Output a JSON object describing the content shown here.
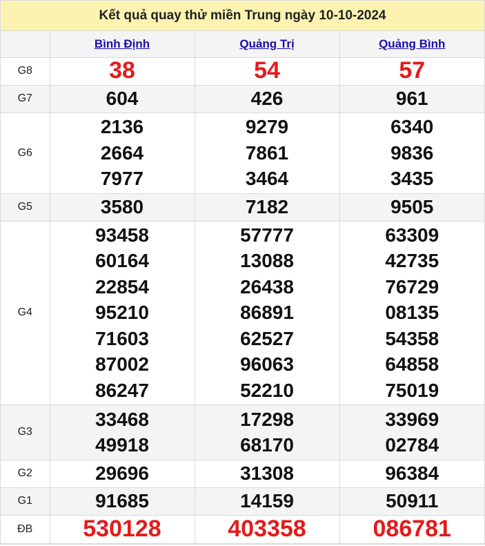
{
  "title": "Kết quả quay thử miền Trung ngày 10-10-2024",
  "provinces": [
    "Bình Định",
    "Quảng Trị",
    "Quảng Bình"
  ],
  "labels": {
    "g8": "G8",
    "g7": "G7",
    "g6": "G6",
    "g5": "G5",
    "g4": "G4",
    "g3": "G3",
    "g2": "G2",
    "g1": "G1",
    "db": "ĐB"
  },
  "results": {
    "g8": [
      "38",
      "54",
      "57"
    ],
    "g7": [
      "604",
      "426",
      "961"
    ],
    "g6": [
      [
        "2136",
        "2664",
        "7977"
      ],
      [
        "9279",
        "7861",
        "3464"
      ],
      [
        "6340",
        "9836",
        "3435"
      ]
    ],
    "g5": [
      "3580",
      "7182",
      "9505"
    ],
    "g4": [
      [
        "93458",
        "60164",
        "22854",
        "95210",
        "71603",
        "87002",
        "86247"
      ],
      [
        "57777",
        "13088",
        "26438",
        "86891",
        "62527",
        "96063",
        "52210"
      ],
      [
        "63309",
        "42735",
        "76729",
        "08135",
        "54358",
        "64858",
        "75019"
      ]
    ],
    "g3": [
      [
        "33468",
        "49918"
      ],
      [
        "17298",
        "68170"
      ],
      [
        "33969",
        "02784"
      ]
    ],
    "g2": [
      "29696",
      "31308",
      "96384"
    ],
    "g1": [
      "91685",
      "14159",
      "50911"
    ],
    "db": [
      "530128",
      "403358",
      "086781"
    ]
  },
  "colors": {
    "title_bg": "#fdf3b1",
    "special": "#e31b1b",
    "link": "#1a0dab",
    "alt_row": "#f4f4f4"
  }
}
